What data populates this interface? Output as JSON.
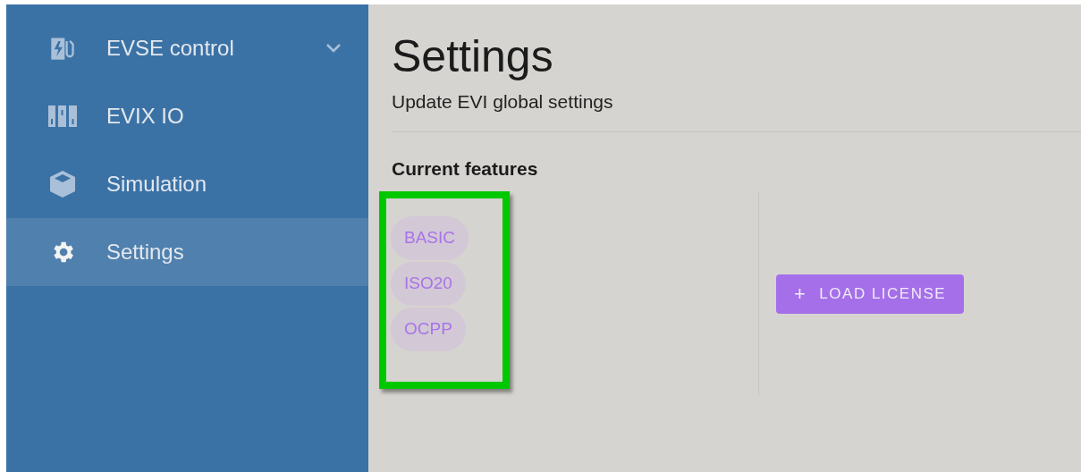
{
  "sidebar": {
    "items": [
      {
        "label": "EVSE control",
        "kind": "charger",
        "selected": false,
        "expandable": true
      },
      {
        "label": "EVIX IO",
        "kind": "modules",
        "selected": false,
        "expandable": false
      },
      {
        "label": "Simulation",
        "kind": "cube",
        "selected": false,
        "expandable": false
      },
      {
        "label": "Settings",
        "kind": "gear",
        "selected": true,
        "expandable": false
      }
    ]
  },
  "page": {
    "title": "Settings",
    "subtitle": "Update EVI global settings"
  },
  "features": {
    "heading": "Current features",
    "highlighted": true,
    "chips": [
      "BASIC",
      "ISO20",
      "OCPP"
    ]
  },
  "load_button": {
    "icon": "+",
    "label": "LOAD LICENSE"
  }
}
